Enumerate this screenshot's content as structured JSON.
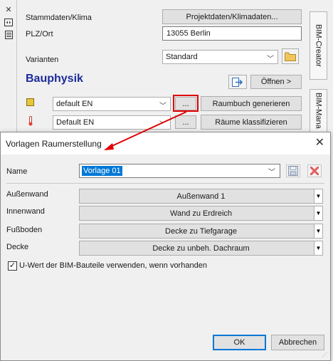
{
  "bg_panel": {
    "tools": [
      "close-icon",
      "view-icon",
      "list-icon"
    ],
    "stammdaten_label": "Stammdaten/Klima",
    "projekt_button": "Projektdaten/Klimadaten...",
    "plz_label": "PLZ/Ort",
    "plz_value": "13055 Berlin",
    "varianten_label": "Varianten",
    "varianten_value": "Standard",
    "section_title": "Bauphysik",
    "oeffnen_button": "Öffnen >",
    "row1": {
      "value": "default EN",
      "dots": "...",
      "action": "Raumbuch generieren"
    },
    "row2": {
      "value": "Default EN",
      "dots": "...",
      "action": "Räume klassifizieren"
    },
    "tabs": [
      "BIM-Creator",
      "BIM-Mana"
    ]
  },
  "dialog": {
    "title": "Vorlagen Raumerstellung",
    "name_label": "Name",
    "name_value": "Vorlage 01",
    "rows": [
      {
        "label": "Außenwand",
        "value": "Außenwand 1"
      },
      {
        "label": "Innenwand",
        "value": "Wand zu Erdreich"
      },
      {
        "label": "Fußboden",
        "value": "Decke zu Tiefgarage"
      },
      {
        "label": "Decke",
        "value": "Decke zu unbeh. Dachraum"
      }
    ],
    "checkbox_label": "U-Wert der BIM-Bauteile verwenden, wenn vorhanden",
    "checkbox_checked": true,
    "ok_button": "OK",
    "cancel_button": "Abbrechen"
  },
  "colors": {
    "accent_blue": "#1c2a9c",
    "highlight_red": "#e00000",
    "selection": "#0078d7"
  }
}
